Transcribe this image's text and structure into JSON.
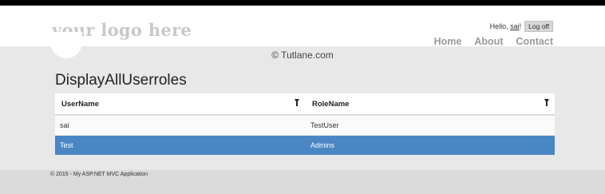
{
  "header": {
    "logo_text": "your logo here",
    "greeting_prefix": "Hello, ",
    "username": "sai",
    "greeting_suffix": "!",
    "logoff_label": "Log off",
    "nav": [
      {
        "label": "Home"
      },
      {
        "label": "About"
      },
      {
        "label": "Contact"
      }
    ]
  },
  "watermark": "© Tutlane.com",
  "page": {
    "title": "DisplayAllUserroles"
  },
  "grid": {
    "columns": [
      {
        "label": "UserName",
        "filter_icon": "filter-icon"
      },
      {
        "label": "RoleName",
        "filter_icon": "filter-icon"
      }
    ],
    "rows": [
      {
        "username": "sai",
        "rolename": "TestUser",
        "selected": false
      },
      {
        "username": "Test",
        "rolename": "Admins",
        "selected": true
      }
    ],
    "selected_row_color": "#4a86c4"
  },
  "footer": {
    "text": "© 2015 - My ASP.NET MVC Application"
  }
}
